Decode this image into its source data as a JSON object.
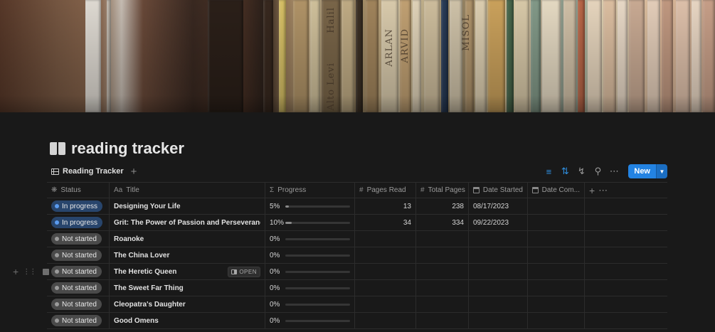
{
  "page": {
    "title": "reading tracker",
    "icon": "book-open-icon"
  },
  "view": {
    "tab_label": "Reading Tracker",
    "new_label": "New"
  },
  "toolbar": {
    "icons": [
      "filter-icon",
      "sort-icon",
      "lightning-icon",
      "search-icon",
      "more-icon"
    ]
  },
  "columns": {
    "status": "Status",
    "title": "Title",
    "title_prefix": "Aa",
    "progress": "Progress",
    "pages_read": "Pages Read",
    "total_pages": "Total Pages",
    "date_started": "Date Started",
    "date_completed": "Date Com..."
  },
  "open_label": "OPEN",
  "rows": [
    {
      "status": "In progress",
      "title": "Designing Your Life",
      "progress": 0.05,
      "progress_label": "5%",
      "pages_read": "13",
      "total_pages": "238",
      "date_started": "08/17/2023",
      "date_completed": ""
    },
    {
      "status": "In progress",
      "title": "Grit: The Power of Passion and Perseverance",
      "progress": 0.1,
      "progress_label": "10%",
      "pages_read": "34",
      "total_pages": "334",
      "date_started": "09/22/2023",
      "date_completed": ""
    },
    {
      "status": "Not started",
      "title": "Roanoke",
      "progress": 0,
      "progress_label": "0%",
      "pages_read": "",
      "total_pages": "",
      "date_started": "",
      "date_completed": ""
    },
    {
      "status": "Not started",
      "title": "The China Lover",
      "progress": 0,
      "progress_label": "0%",
      "pages_read": "",
      "total_pages": "",
      "date_started": "",
      "date_completed": ""
    },
    {
      "status": "Not started",
      "title": "The Heretic Queen",
      "progress": 0,
      "progress_label": "0%",
      "pages_read": "",
      "total_pages": "",
      "date_started": "",
      "date_completed": ""
    },
    {
      "status": "Not started",
      "title": "The Sweet Far Thing",
      "progress": 0,
      "progress_label": "0%",
      "pages_read": "",
      "total_pages": "",
      "date_started": "",
      "date_completed": ""
    },
    {
      "status": "Not started",
      "title": "Cleopatra's Daughter",
      "progress": 0,
      "progress_label": "0%",
      "pages_read": "",
      "total_pages": "",
      "date_started": "",
      "date_completed": ""
    },
    {
      "status": "Not started",
      "title": "Good Omens",
      "progress": 0,
      "progress_label": "0%",
      "pages_read": "",
      "total_pages": "",
      "date_started": "",
      "date_completed": ""
    }
  ],
  "hover_row_index": 4,
  "cover": {
    "spine_texts": [
      "Halil",
      "Alto Levi",
      "ARVID",
      "ARLAN",
      "MISOL"
    ]
  },
  "colors": {
    "accent": "#2383e2",
    "in_progress": "#28456c",
    "not_started": "#4a4a4a",
    "background": "#191919"
  }
}
